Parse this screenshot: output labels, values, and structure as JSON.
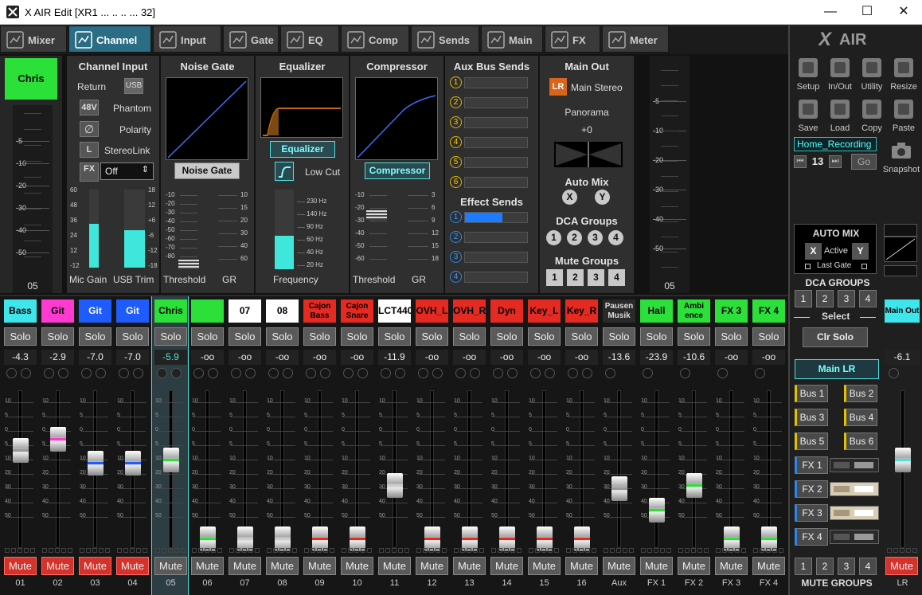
{
  "window": {
    "title": "X AIR Edit [XR1      ...          ..  ..  ...  32]",
    "min": "—",
    "max": "☐",
    "close": "✕"
  },
  "tabs": [
    {
      "label": "Mixer",
      "icon": "mixer-icon"
    },
    {
      "label": "Channel",
      "icon": "channel-icon"
    },
    {
      "label": "Input",
      "icon": "input-icon"
    },
    {
      "label": "Gate",
      "icon": "gate-icon"
    },
    {
      "label": "EQ",
      "icon": "eq-icon"
    },
    {
      "label": "Comp",
      "icon": "comp-icon"
    },
    {
      "label": "Sends",
      "icon": "sends-icon"
    },
    {
      "label": "Main",
      "icon": "main-icon"
    },
    {
      "label": "FX",
      "icon": "fx-icon"
    },
    {
      "label": "Meter",
      "icon": "meter-icon"
    }
  ],
  "channel": {
    "name": "Chris",
    "number": "05",
    "input": {
      "title": "Channel Input",
      "return": "Return",
      "usb": "USB",
      "phantom_btn": "48V",
      "phantom": "Phantom",
      "polarity_btn": "∅",
      "polarity": "Polarity",
      "stereolink_btn": "L",
      "stereolink": "StereoLink",
      "fx_btn": "FX",
      "stereo_select": "Off",
      "mic_gain": "Mic Gain",
      "usb_trim": "USB Trim",
      "mic_gain_level": 0.56,
      "usb_trim_level": 0.48
    },
    "gate": {
      "title": "Noise Gate",
      "button": "Noise Gate",
      "threshold": "Threshold",
      "gr": "GR"
    },
    "eq": {
      "title": "Equalizer",
      "button": "Equalizer",
      "lowcut": "Low Cut",
      "frequency": "Frequency",
      "freq_ticks": [
        "230 Hz",
        "140 Hz",
        "90 Hz",
        "60 Hz",
        "40 Hz",
        "20 Hz"
      ]
    },
    "comp": {
      "title": "Compressor",
      "button": "Compressor",
      "threshold": "Threshold",
      "gr": "GR"
    },
    "aux": {
      "title": "Aux Bus Sends",
      "buses": [
        "1",
        "2",
        "3",
        "4",
        "5",
        "6"
      ],
      "fx_title": "Effect Sends",
      "fx": [
        "1",
        "2",
        "3",
        "4"
      ],
      "fx_levels": [
        0.6,
        0,
        0,
        0
      ]
    },
    "main": {
      "title": "Main Out",
      "lr": "LR",
      "main_stereo": "Main Stereo",
      "panorama": "Panorama",
      "pan_value": "+0",
      "automix": "Auto Mix",
      "x": "X",
      "y": "Y",
      "dca": "DCA Groups",
      "dca_items": [
        "1",
        "2",
        "3",
        "4"
      ],
      "mute": "Mute Groups",
      "mute_items": [
        "1",
        "2",
        "3",
        "4"
      ]
    }
  },
  "left_scale": [
    "-5",
    "-10",
    "-20",
    "-30",
    "-40",
    "-50"
  ],
  "gain_scale_left": [
    "60",
    "48",
    "36",
    "24",
    "12",
    "-12"
  ],
  "gain_scale_right": [
    "18",
    "12",
    "+6",
    "-6",
    "-12",
    "-18"
  ],
  "gate_scale": [
    "-10",
    "-20",
    "-30",
    "-40",
    "-50",
    "-60",
    "-70",
    "-80"
  ],
  "gr_scale": [
    "10",
    "15",
    "20",
    "30",
    "40",
    "60"
  ],
  "comp_scale": [
    "-10",
    "-20",
    "-30",
    "-40",
    "-50",
    "-60"
  ],
  "comp_gr": [
    "3",
    "6",
    "9",
    "12",
    "15",
    "18"
  ],
  "fader_scale": [
    "10",
    "5",
    "0",
    "5",
    "10",
    "20",
    "30",
    "40",
    "50"
  ],
  "strips": [
    {
      "name": "Bass",
      "color": "#3ee6ec",
      "text": "#000",
      "level": "-4.3",
      "fader": 0.62,
      "line": "#999",
      "mute": true,
      "num": "01"
    },
    {
      "name": "Git",
      "color": "#ff3ad0",
      "text": "#000",
      "level": "-2.9",
      "fader": 0.69,
      "line": "#ff3ad0",
      "mute": true,
      "num": "02"
    },
    {
      "name": "Git Solo",
      "color": "#1e5cff",
      "text": "#fff",
      "level": "-7.0",
      "fader": 0.54,
      "line": "#1e5cff",
      "mute": true,
      "num": "03"
    },
    {
      "name": "Git Solo",
      "color": "#1e5cff",
      "text": "#fff",
      "level": "-7.0",
      "fader": 0.54,
      "line": "#1e5cff",
      "mute": true,
      "num": "04"
    },
    {
      "name": "Chris",
      "color": "#2ce03a",
      "text": "#000",
      "level": "-5.9",
      "fader": 0.56,
      "line": "#2ce03a",
      "mute": false,
      "num": "05"
    },
    {
      "name": "",
      "color": "#2ce03a",
      "text": "#000",
      "level": "-oo",
      "fader": 0.06,
      "line": "#2ce03a",
      "mute": false,
      "num": "06"
    },
    {
      "name": "07",
      "color": "#ffffff",
      "text": "#000",
      "level": "-oo",
      "fader": 0.06,
      "line": "#ccc",
      "mute": false,
      "num": "07"
    },
    {
      "name": "08",
      "color": "#ffffff",
      "text": "#000",
      "level": "-oo",
      "fader": 0.06,
      "line": "#ccc",
      "mute": false,
      "num": "08"
    },
    {
      "name": "Cajon Bass",
      "color": "#e52a22",
      "text": "#000",
      "level": "-oo",
      "fader": 0.06,
      "line": "#e52a22",
      "mute": false,
      "num": "09",
      "two": true
    },
    {
      "name": "Cajon Snare",
      "color": "#e52a22",
      "text": "#000",
      "level": "-oo",
      "fader": 0.06,
      "line": "#e52a22",
      "mute": false,
      "num": "10",
      "two": true
    },
    {
      "name": "LCT440",
      "color": "#ffffff",
      "text": "#000",
      "level": "-11.9",
      "fader": 0.4,
      "line": "#ccc",
      "mute": false,
      "num": "11"
    },
    {
      "name": "OVH_L",
      "color": "#e52a22",
      "text": "#000",
      "level": "-oo",
      "fader": 0.06,
      "line": "#e52a22",
      "mute": false,
      "num": "12"
    },
    {
      "name": "OVH_R",
      "color": "#e52a22",
      "text": "#000",
      "level": "-oo",
      "fader": 0.06,
      "line": "#e52a22",
      "mute": false,
      "num": "13"
    },
    {
      "name": "Dyn",
      "color": "#e52a22",
      "text": "#000",
      "level": "-oo",
      "fader": 0.06,
      "line": "#e52a22",
      "mute": false,
      "num": "14"
    },
    {
      "name": "Key_L",
      "color": "#e52a22",
      "text": "#000",
      "level": "-oo",
      "fader": 0.06,
      "line": "#e52a22",
      "mute": false,
      "num": "15"
    },
    {
      "name": "Key_R",
      "color": "#e52a22",
      "text": "#000",
      "level": "-oo",
      "fader": 0.06,
      "line": "#e52a22",
      "mute": false,
      "num": "16"
    },
    {
      "name": "Pausen Musik",
      "color": "#2a2a2a",
      "text": "#ddd",
      "level": "-13.6",
      "fader": 0.38,
      "line": "#999",
      "mute": false,
      "num": "Aux",
      "two": true
    },
    {
      "name": "Hall",
      "color": "#2ce03a",
      "text": "#000",
      "level": "-23.9",
      "fader": 0.24,
      "line": "#2ce03a",
      "mute": false,
      "num": "FX 1"
    },
    {
      "name": "Ambi ence",
      "color": "#2ce03a",
      "text": "#000",
      "level": "-10.6",
      "fader": 0.4,
      "line": "#2ce03a",
      "mute": false,
      "num": "FX 2",
      "two": true
    },
    {
      "name": "FX 3",
      "color": "#2ce03a",
      "text": "#000",
      "level": "-oo",
      "fader": 0.06,
      "line": "#2ce03a",
      "mute": false,
      "num": "FX 3"
    },
    {
      "name": "FX 4",
      "color": "#2ce03a",
      "text": "#000",
      "level": "-oo",
      "fader": 0.06,
      "line": "#2ce03a",
      "mute": false,
      "num": "FX 4"
    }
  ],
  "main_strip": {
    "name": "Main Out",
    "level": "-6.1",
    "mute": "Mute",
    "num": "LR",
    "fader": 0.56
  },
  "strip_labels": {
    "solo": "Solo",
    "mute": "Mute"
  },
  "right": {
    "tools": [
      "Setup",
      "In/Out",
      "Utility",
      "Resize",
      "Save",
      "Load",
      "Copy",
      "Paste"
    ],
    "scene": "Home_Recording",
    "scene_num": "13",
    "go": "Go",
    "snapshot": "Snapshot",
    "automix": "AUTO MIX",
    "x": "X",
    "active": "Active",
    "y": "Y",
    "last_gate": "Last Gate",
    "dca_groups": "DCA GROUPS",
    "dca": [
      "1",
      "2",
      "3",
      "4"
    ],
    "select": "Select",
    "clr_solo": "Clr Solo",
    "main_lr": "Main LR",
    "buses": [
      "Bus 1",
      "Bus 2",
      "Bus 3",
      "Bus 4",
      "Bus 5",
      "Bus 6"
    ],
    "fx": [
      "FX 1",
      "FX 2",
      "FX 3",
      "FX 4"
    ],
    "mute_items": [
      "1",
      "2",
      "3",
      "4"
    ],
    "mute_groups": "MUTE GROUPS"
  }
}
